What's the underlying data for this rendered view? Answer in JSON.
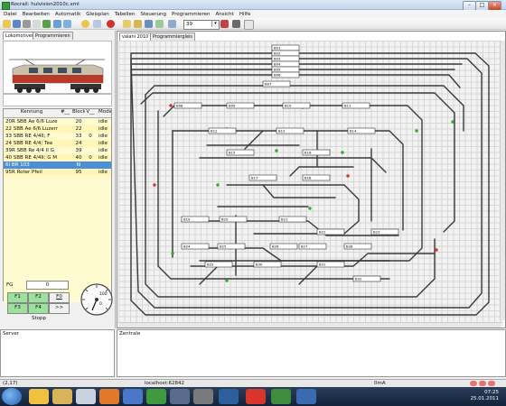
{
  "window": {
    "title": "Rocrail: hulvision2010c.xml"
  },
  "menu": [
    "Datei",
    "Bearbeiten",
    "Automatik",
    "Gleisplan",
    "Tabellen",
    "Steuerung",
    "Programmieren",
    "Ansicht",
    "Hilfe"
  ],
  "toolbar": {
    "zoom": "39"
  },
  "left": {
    "tabs": [
      "Lokomotiven",
      "Programmieren"
    ],
    "table": {
      "headers": [
        "Kennung",
        "#__",
        "Block",
        "V__",
        "Mode"
      ],
      "rows": [
        {
          "name": "20R SBB Ae 6/6 Luzern",
          "num": "",
          "block": "20",
          "v": "",
          "mode": "idle"
        },
        {
          "name": "22 SBB Ae 6/6 Luzern",
          "num": "",
          "block": "22",
          "v": "",
          "mode": "idle"
        },
        {
          "name": "33 SBB RE 4/4II; F",
          "num": "",
          "block": "33",
          "v": "0",
          "mode": "idle"
        },
        {
          "name": "24 SBB RE 4/4; Tee",
          "num": "",
          "block": "24",
          "v": "",
          "mode": "idle"
        },
        {
          "name": "39R SBB Re 4/4 II G",
          "num": "",
          "block": "39",
          "v": "",
          "mode": "idle"
        },
        {
          "name": "40 SBB RE 4/4II; G M",
          "num": "",
          "block": "40",
          "v": "0",
          "mode": "idle"
        },
        {
          "name": "6I BR 103",
          "num": "",
          "block": "6I",
          "v": "",
          "mode": ""
        },
        {
          "name": "95R Roter Pfeil",
          "num": "",
          "block": "95",
          "v": "",
          "mode": "idle"
        }
      ]
    },
    "throttle": {
      "fg_label": "FG",
      "fg_value": "0",
      "buttons": [
        "F1",
        "F2",
        "F0",
        "F3",
        "F4",
        ">>"
      ],
      "stop_label": "Stopp",
      "gauge_top": "100",
      "gauge_bottom": "0"
    }
  },
  "right": {
    "tabs": [
      "valani 2010",
      "Programmiergleis"
    ],
    "blocks": [
      "B01",
      "B02",
      "B03",
      "B04",
      "B05",
      "B06",
      "B07",
      "B08",
      "B09",
      "B10",
      "B11",
      "B12",
      "B13",
      "B14",
      "B15",
      "B16",
      "B17",
      "B18",
      "B19",
      "B20",
      "B21",
      "B22",
      "B23",
      "B24",
      "B25",
      "B26",
      "B27",
      "B28",
      "B29",
      "B30",
      "B31",
      "B32"
    ]
  },
  "panes": {
    "server": "Server",
    "zentrale": "Zentrale"
  },
  "status": {
    "pos": "(2,17)",
    "host": "localhost:62842",
    "current": "0mA"
  },
  "taskbar": {
    "time": "07:25",
    "date": "25.01.2011"
  }
}
